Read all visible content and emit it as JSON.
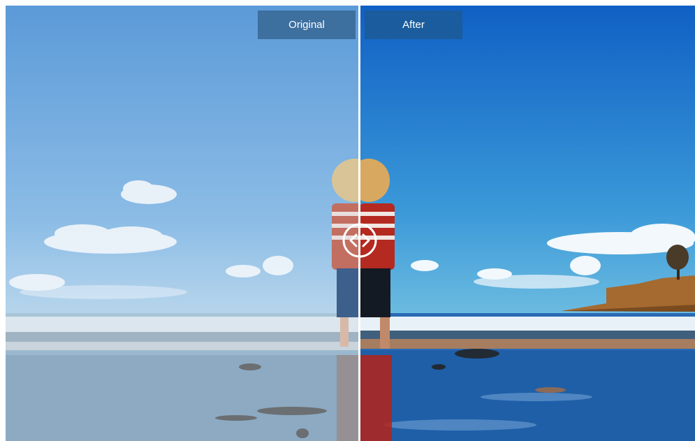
{
  "comparison": {
    "original_label": "Original",
    "after_label": "After"
  },
  "handle": {
    "icon": "compare-arrows-icon"
  },
  "colors": {
    "original_label_bg": "#3d6f9f",
    "after_label_bg": "#1a5c9d",
    "divider": "#ffffff"
  }
}
